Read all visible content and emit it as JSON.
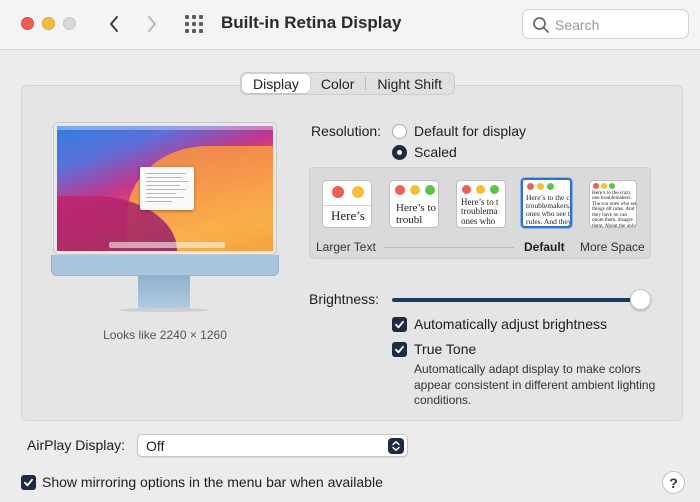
{
  "window": {
    "title": "Built-in Retina Display",
    "search_placeholder": "Search"
  },
  "tabs": [
    {
      "label": "Display",
      "active": true
    },
    {
      "label": "Color",
      "active": false
    },
    {
      "label": "Night Shift",
      "active": false
    }
  ],
  "display_preview": {
    "looks_like": "Looks like 2240 × 1260"
  },
  "resolution": {
    "label": "Resolution:",
    "options": [
      {
        "label": "Default for display",
        "selected": false
      },
      {
        "label": "Scaled",
        "selected": true
      }
    ],
    "scaled_thumbnails": [
      {
        "text": "Here’s",
        "selected": false
      },
      {
        "text": "Here’s to troubl",
        "selected": false
      },
      {
        "text": "Here’s to t troublema ones who",
        "selected": false
      },
      {
        "text": "Here’s to the c troublemakers. ones who see t rules. And they",
        "selected": true
      },
      {
        "text": "Here’s to the crazy one troublemakers. The rou ones who see things dif rules. And they have no can quote them, disagre them. About the only thi Because they change th",
        "selected": false
      }
    ],
    "scale_labels": {
      "larger": "Larger Text",
      "default": "Default",
      "more_space": "More Space"
    }
  },
  "brightness": {
    "label": "Brightness:",
    "level": 0.98,
    "auto_adjust_label": "Automatically adjust brightness",
    "auto_adjust_checked": true,
    "true_tone_label": "True Tone",
    "true_tone_checked": true,
    "true_tone_description": "Automatically adapt display to make colors appear consistent in different ambient lighting conditions."
  },
  "airplay": {
    "label": "AirPlay Display:",
    "value": "Off"
  },
  "mirroring": {
    "label": "Show mirroring options in the menu bar when available",
    "checked": true
  },
  "help_label": "?",
  "colors": {
    "accent": "#1f2a44",
    "selection_border": "#2f6fd0",
    "close": "#ee5e57",
    "minimize": "#f4bd3a"
  }
}
